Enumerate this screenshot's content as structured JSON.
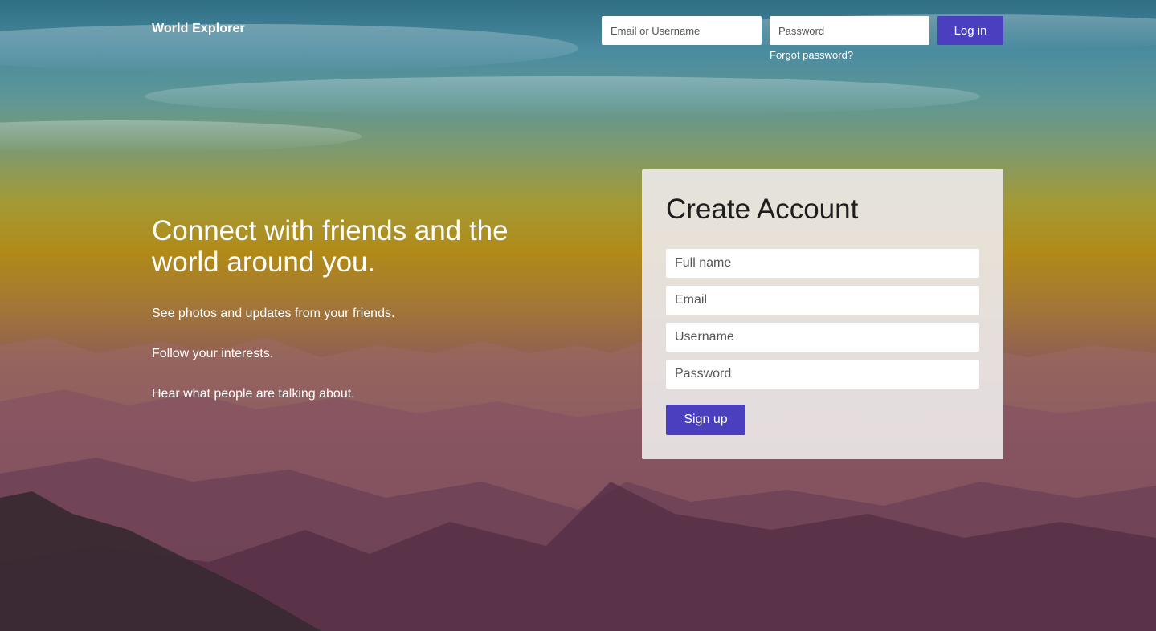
{
  "header": {
    "brand": "World Explorer",
    "login": {
      "username_placeholder": "Email or Username",
      "password_placeholder": "Password",
      "login_label": "Log in",
      "forgot_label": "Forgot password?"
    }
  },
  "hero": {
    "headline": "Connect with friends and the world around you.",
    "lines": [
      "See photos and updates from your friends.",
      "Follow your interests.",
      "Hear what people are talking about."
    ]
  },
  "signup": {
    "title": "Create Account",
    "full_name_placeholder": "Full name",
    "email_placeholder": "Email",
    "username_placeholder": "Username",
    "password_placeholder": "Password",
    "signup_label": "Sign up"
  },
  "colors": {
    "accent": "#4a3fbf"
  }
}
